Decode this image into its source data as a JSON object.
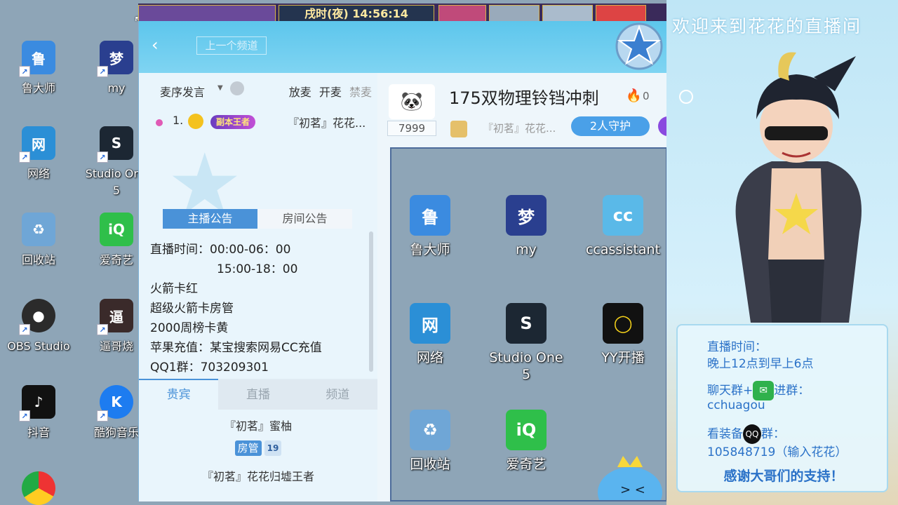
{
  "desktop": {
    "icons": [
      {
        "label": "鲁大师",
        "color": "#3b8be0",
        "glyph": "鲁"
      },
      {
        "label": "my",
        "color": "#2a3f8f",
        "glyph": "梦"
      },
      {
        "label": "网络",
        "color": "#2b8fd6",
        "glyph": "网"
      },
      {
        "label": "Studio One",
        "label2": "5",
        "color": "#1c2733",
        "glyph": "S"
      },
      {
        "label": "回收站",
        "color": "#6fa6d6",
        "glyph": "♻"
      },
      {
        "label": "爱奇艺",
        "color": "#2fbf4a",
        "glyph": "iQ"
      },
      {
        "label": "OBS Studio",
        "color": "#2b2b2b",
        "glyph": "●"
      },
      {
        "label": "逼哥烧",
        "color": "#3a2a2a",
        "glyph": "逼"
      },
      {
        "label": "抖音",
        "color": "#111111",
        "glyph": "♪"
      },
      {
        "label": "酷狗音乐",
        "color": "#1d7cf0",
        "glyph": "K"
      }
    ]
  },
  "topstrip": {
    "clock": "戌时(夜)  14:56:14"
  },
  "cc": {
    "prev_channel": "上一个频道",
    "mic_mode": "麦序发言",
    "mic_actions": [
      "放麦",
      "开麦",
      "禁麦"
    ],
    "queue": {
      "num": "1.",
      "rank": "副本王者",
      "nick": "『初茗』花花..."
    },
    "notice_tabs": [
      "主播公告",
      "房间公告"
    ],
    "notice_lines": [
      "直播时间：00:00-06：00",
      "15:00-18：00",
      "火箭卡红",
      "超级火箭卡房管",
      "2000周榜卡黄",
      "苹果充值：某宝搜索网易CC充值",
      "QQ1群：703209301"
    ],
    "bottom_tabs": [
      "贵宾",
      "直播",
      "频道"
    ],
    "vips": [
      {
        "name": "『初茗』蜜柚",
        "role": "房管",
        "level": "19"
      },
      {
        "name": "『初茗』花花归墟王者"
      }
    ],
    "anchor_id": "7999",
    "room_title": "175双物理铃铛冲刺",
    "heat": "0",
    "room_owner": "『初茗』花花...",
    "guard_label": "2人守护",
    "stream_icons": [
      {
        "label": "鲁大师",
        "color": "#3b8be0",
        "glyph": "鲁"
      },
      {
        "label": "my",
        "color": "#2a3f8f",
        "glyph": "梦"
      },
      {
        "label": "ccassistant",
        "color": "#5ab9e8",
        "glyph": "cc"
      },
      {
        "label": "网络",
        "color": "#2b8fd6",
        "glyph": "网"
      },
      {
        "label": "Studio One",
        "label2": "5",
        "color": "#1c2733",
        "glyph": "S"
      },
      {
        "label": "YY开播",
        "color": "#111111",
        "glyph": "◯"
      },
      {
        "label": "回收站",
        "color": "#6fa6d6",
        "glyph": "♻"
      },
      {
        "label": "爱奇艺",
        "color": "#2fbf4a",
        "glyph": "iQ"
      }
    ]
  },
  "overlay": {
    "welcome": "欢迎来到花花的直播间",
    "time_title": "直播时间：",
    "time_value": "晚上12点到早上6点",
    "chat_pre": "聊天群+",
    "chat_post": "进群：",
    "chat_id": "cchuagou",
    "equip_pre": "看装备",
    "equip_post": "群：",
    "equip_id": "105848719（输入花花）",
    "thanks": "感谢大哥们的支持！"
  }
}
